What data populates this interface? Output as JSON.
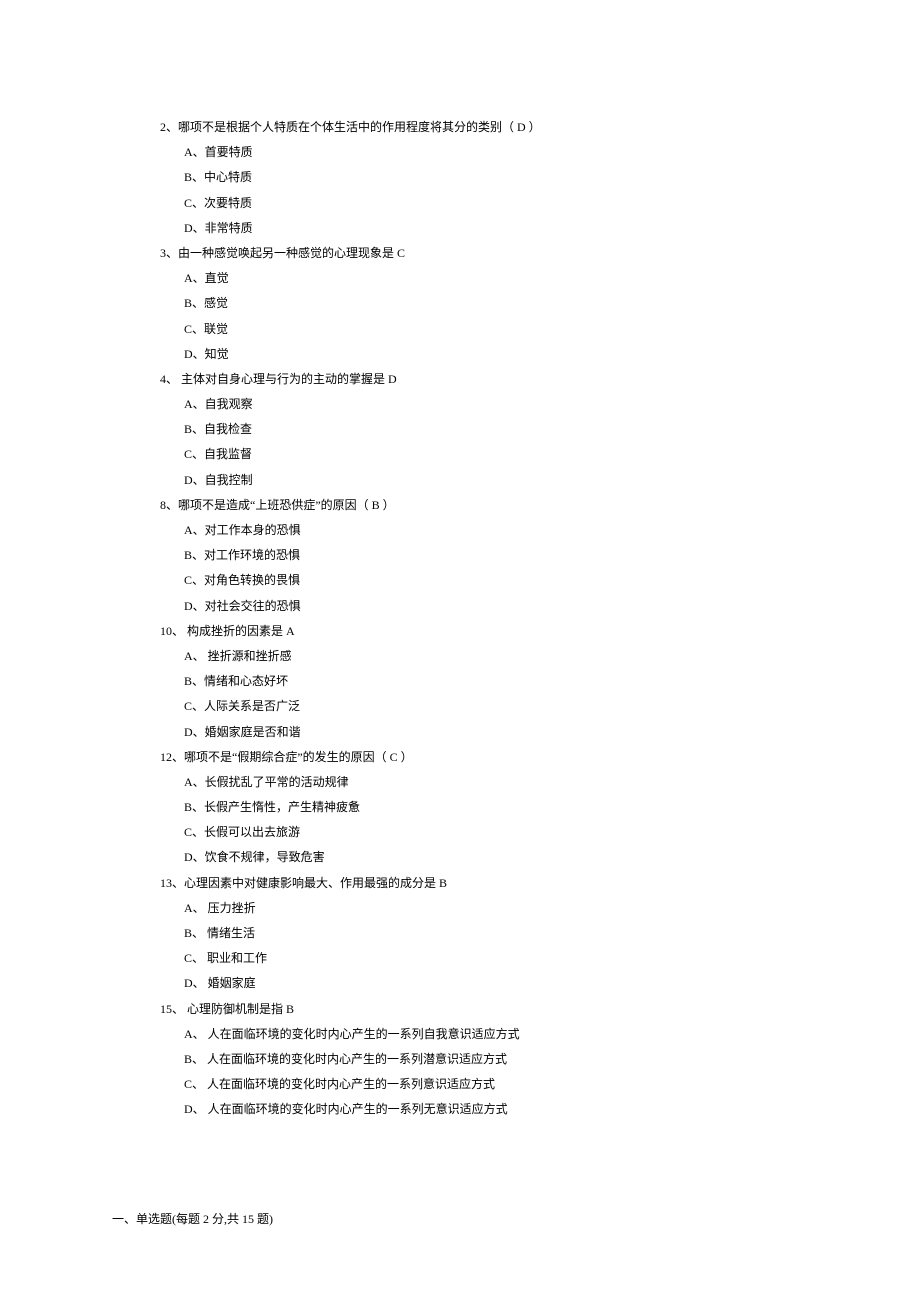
{
  "questions": [
    {
      "number": "2",
      "text": "哪项不是根据个人特质在个体生活中的作用程度将其分的类别（ D ）",
      "options": [
        "A、首要特质",
        "B、中心特质",
        "C、次要特质",
        "D、非常特质"
      ]
    },
    {
      "number": "3",
      "text": "由一种感觉唤起另一种感觉的心理现象是 C",
      "options": [
        "A、直觉",
        "B、感觉",
        "C、联觉",
        "D、知觉"
      ]
    },
    {
      "number": "4",
      "text": " 主体对自身心理与行为的主动的掌握是 D",
      "options": [
        "A、自我观察",
        "B、自我检查",
        "C、自我监督",
        "D、自我控制"
      ]
    },
    {
      "number": "8",
      "text": "哪项不是造成“上班恐供症”的原因（ B ）",
      "options": [
        "A、对工作本身的恐惧",
        "B、对工作环境的恐惧",
        "C、对角色转换的畏惧",
        "D、对社会交往的恐惧"
      ]
    },
    {
      "number": "10",
      "text": " 构成挫折的因素是 A",
      "options": [
        "A、 挫折源和挫折感",
        "B、情绪和心态好坏",
        "C、人际关系是否广泛",
        "D、婚姻家庭是否和谐"
      ]
    },
    {
      "number": "12",
      "text": "哪项不是“假期综合症”的发生的原因（ C ）",
      "options": [
        "A、长假扰乱了平常的活动规律",
        "B、长假产生惰性，产生精神疲惫",
        "C、长假可以出去旅游",
        "D、饮食不规律，导致危害"
      ]
    },
    {
      "number": "13",
      "text": "心理因素中对健康影响最大、作用最强的成分是 B",
      "options": [
        "A、 压力挫折",
        "B、 情绪生活",
        "C、 职业和工作",
        "D、 婚姻家庭"
      ]
    },
    {
      "number": "15",
      "text": " 心理防御机制是指 B",
      "options": [
        "A、 人在面临环境的变化时内心产生的一系列自我意识适应方式",
        "B、 人在面临环境的变化时内心产生的一系列潜意识适应方式",
        "C、 人在面临环境的变化时内心产生的一系列意识适应方式",
        "D、 人在面临环境的变化时内心产生的一系列无意识适应方式"
      ]
    }
  ],
  "section_header": "一、单选题(每题 2 分,共 15 题)"
}
